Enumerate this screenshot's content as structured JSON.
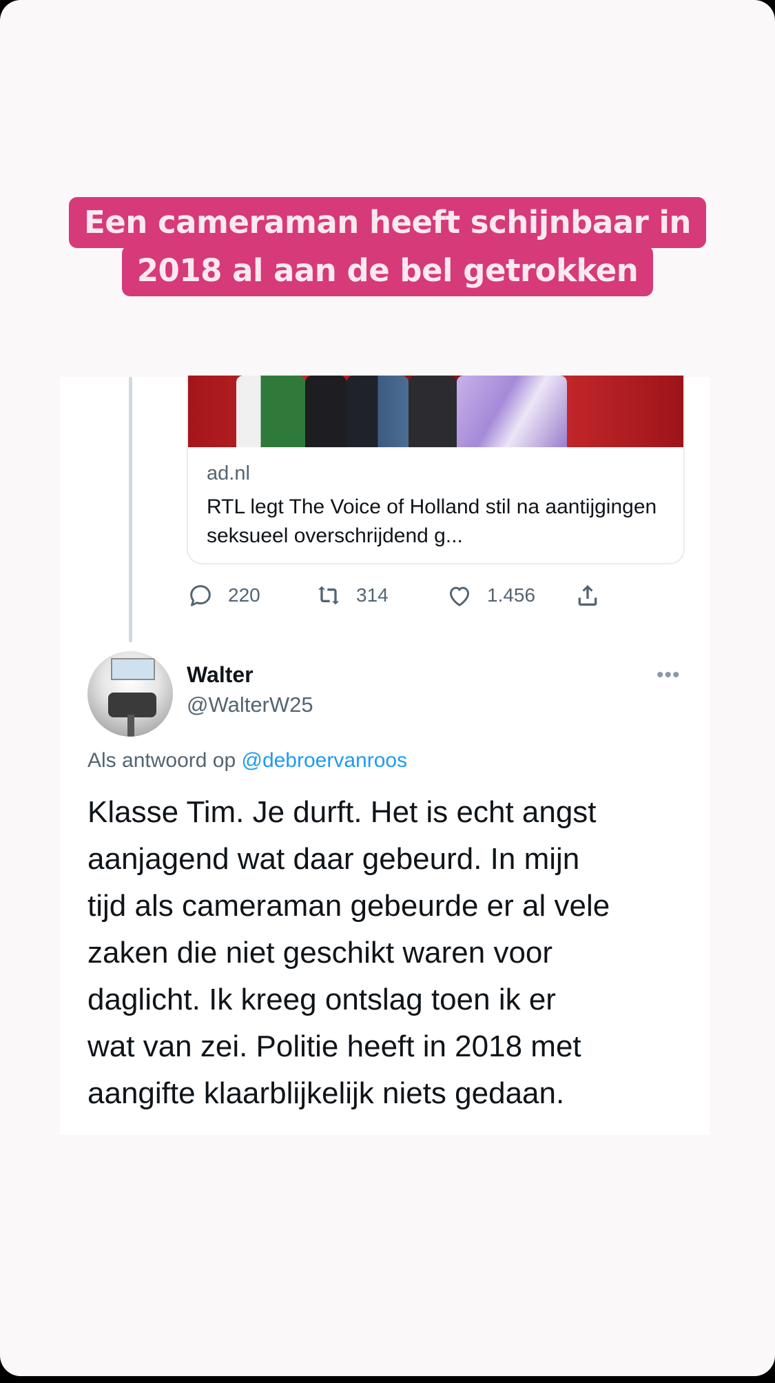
{
  "caption": {
    "line1": "Een cameraman heeft schijnbaar in",
    "line2": "2018 al aan de bel getrokken"
  },
  "quoted_link": {
    "domain": "ad.nl",
    "title": "RTL legt The Voice of Holland stil na aantijgingen seksueel overschrijdend g..."
  },
  "actions": {
    "replies": "220",
    "retweets": "314",
    "likes": "1.456"
  },
  "reply_tweet": {
    "name": "Walter",
    "handle": "@WalterW25",
    "reply_prefix": "Als antwoord op",
    "reply_mention": "@debroervanroos",
    "text": "Klasse Tim. Je durft. Het is echt angst\naanjagend wat daar gebeurd. In mijn\ntijd als cameraman gebeurde er al vele\nzaken die niet geschikt waren voor\ndaglicht.  Ik kreeg ontslag toen ik er\nwat van zei.  Politie heeft in 2018 met\naangifte klaarblijkelijk niets gedaan.",
    "more_icon": "•••"
  },
  "icons": {
    "reply": "reply-icon",
    "retweet": "retweet-icon",
    "like": "heart-icon",
    "share": "share-icon",
    "more": "more-icon"
  },
  "colors": {
    "caption_bg": "#d63a78",
    "caption_text": "#fbe9ef",
    "mention": "#1d9bf0",
    "muted": "#536471",
    "story_bg": "#fbf8f9"
  }
}
